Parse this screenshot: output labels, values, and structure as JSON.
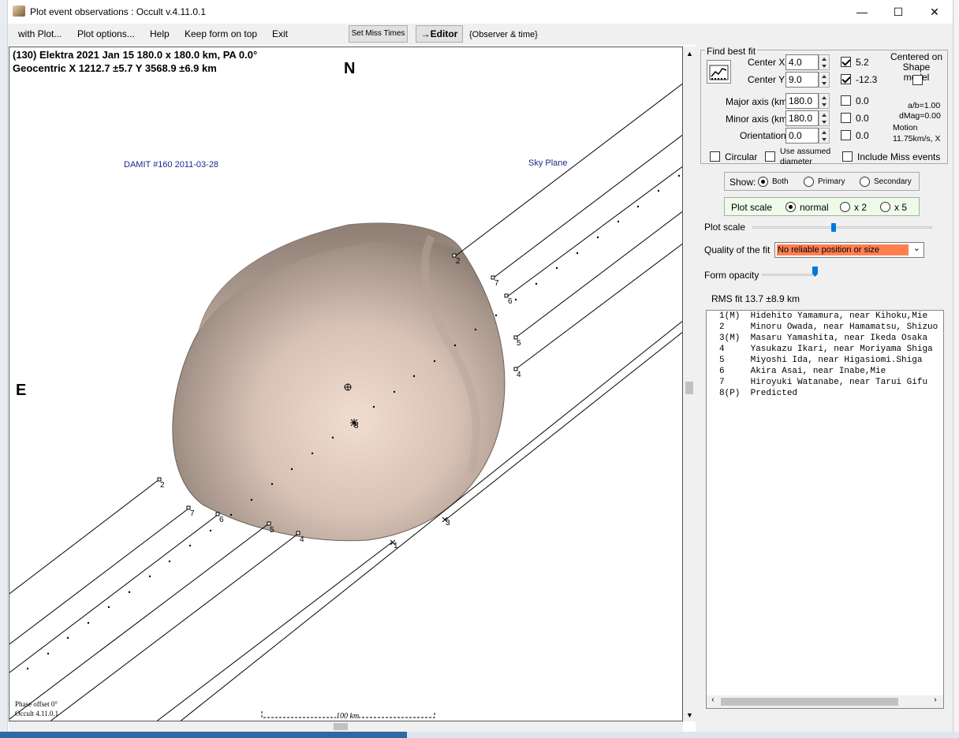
{
  "window": {
    "title": "Plot event observations : Occult v.4.11.0.1",
    "minimize": "—",
    "maximize": "☐",
    "close": "✕"
  },
  "menu": {
    "items": [
      "with Plot...",
      "Plot options...",
      "Help",
      "Keep form on top",
      "Exit"
    ],
    "set_miss_times": "Set Miss Times",
    "editor": "→Editor",
    "observer_time": "{Observer & time}"
  },
  "plot": {
    "header_line1": "(130) Elektra  2021 Jan 15   180.0 x 180.0 km, PA 0.0°",
    "header_line2": "Geocentric  X  1212.7 ±5.7  Y 3568.9 ±6.9 km",
    "north": "N",
    "east": "E",
    "model_label": "DAMIT #160 2011-03-28",
    "sky_plane": "Sky Plane",
    "phase_offset": "Phase offset 0°",
    "version": "Occult 4.11.0.1",
    "scale_label": "100 km",
    "chord_labels": [
      "2",
      "7",
      "6",
      "5",
      "4",
      "2",
      "7",
      "6",
      "5",
      "4",
      "1",
      "3",
      "8"
    ]
  },
  "fit": {
    "group_title": "Find best fit",
    "center_x_label": "Center X",
    "center_x": "4.0",
    "center_x_check": "5.2",
    "center_y_label": "Center Y",
    "center_y": "9.0",
    "center_y_check": "-12.3",
    "centered_label": "Centered on Shape model",
    "major_label": "Major axis (km)",
    "major": "180.0",
    "major_check": "0.0",
    "minor_label": "Minor axis (km)",
    "minor": "180.0",
    "minor_check": "0.0",
    "orient_label": "Orientation",
    "orient": "0.0",
    "orient_check": "0.0",
    "ab": "a/b=1.00",
    "dmag": "dMag=0.00",
    "motion1": "Motion",
    "motion2": "11.75km/s, X",
    "circular": "Circular",
    "assumed1": "Use assumed",
    "assumed2": "diameter",
    "include_miss": "Include Miss events"
  },
  "show": {
    "label": "Show:",
    "both": "Both",
    "primary": "Primary",
    "secondary": "Secondary"
  },
  "scale": {
    "label": "Plot scale",
    "normal": "normal",
    "x2": "x 2",
    "x5": "x 5",
    "slider_label": "Plot scale",
    "slider_value": 0.45
  },
  "quality": {
    "label": "Quality of the fit",
    "value": "No reliable position or size",
    "color": "#ff7f50"
  },
  "opacity": {
    "label": "Form opacity",
    "value": 1.0
  },
  "rms": "RMS fit 13.7 ±8.9 km",
  "observers": [
    "1(M)  Hidehito Yamamura, near Kihoku,Mie",
    "2     Minoru Owada, near Hamamatsu, Shizuo",
    "3(M)  Masaru Yamashita, near Ikeda Osaka",
    "4     Yasukazu Ikari, near Moriyama Shiga",
    "5     Miyoshi Ida, near Higasiomi.Shiga",
    "6     Akira Asai, near Inabe,Mie",
    "7     Hiroyuki Watanabe, near Tarui Gifu",
    "8(P)  Predicted"
  ]
}
